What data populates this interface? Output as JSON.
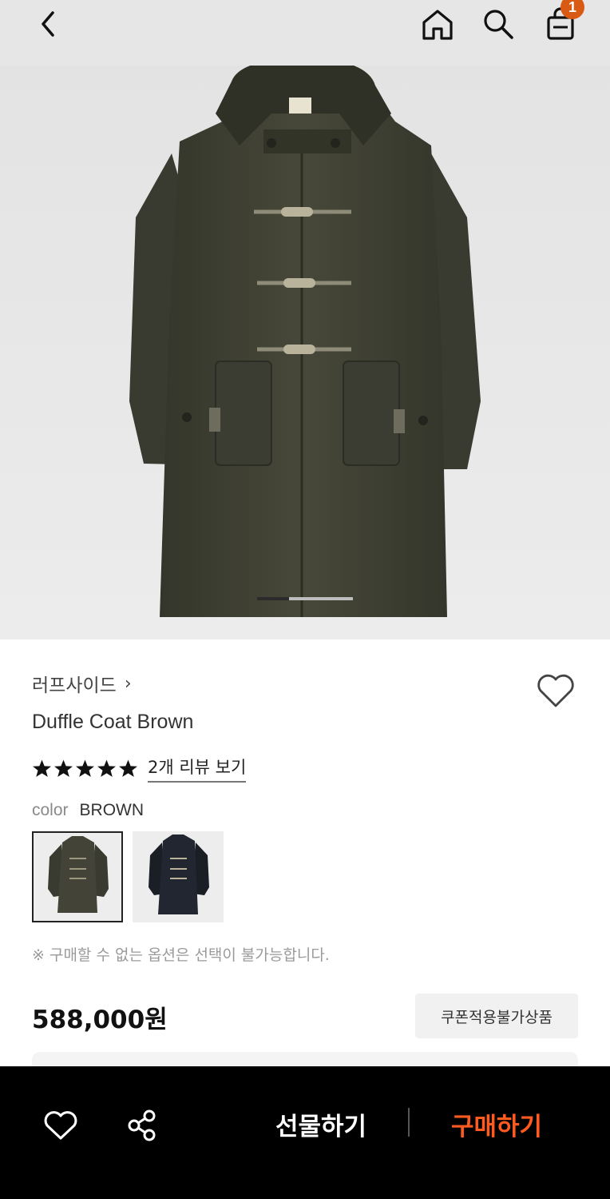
{
  "header": {
    "cart_count": "1"
  },
  "product": {
    "brand": "러프사이드",
    "name": "Duffle Coat Brown",
    "rating_stars": 5,
    "review_link": "2개 리뷰 보기",
    "color_label": "color",
    "color_value": "BROWN",
    "swatches": [
      "BROWN",
      "NAVY"
    ],
    "notice": "※ 구매할 수 없는 옵션은 선택이 불가능합니다.",
    "price": "588,000원",
    "coupon_badge": "쿠폰적용불가상품",
    "image_page": 1,
    "image_page_total": 3
  },
  "bottom_bar": {
    "gift_label": "선물하기",
    "buy_label": "구매하기"
  },
  "colors": {
    "accent": "#ff5a1f",
    "badge": "#d95a12",
    "coat_brown": "#3f4033",
    "coat_navy": "#1e2128"
  },
  "icons": [
    "back-icon",
    "home-icon",
    "search-icon",
    "cart-icon",
    "chevron-right-icon",
    "heart-outline-icon",
    "star-icon",
    "share-icon"
  ]
}
